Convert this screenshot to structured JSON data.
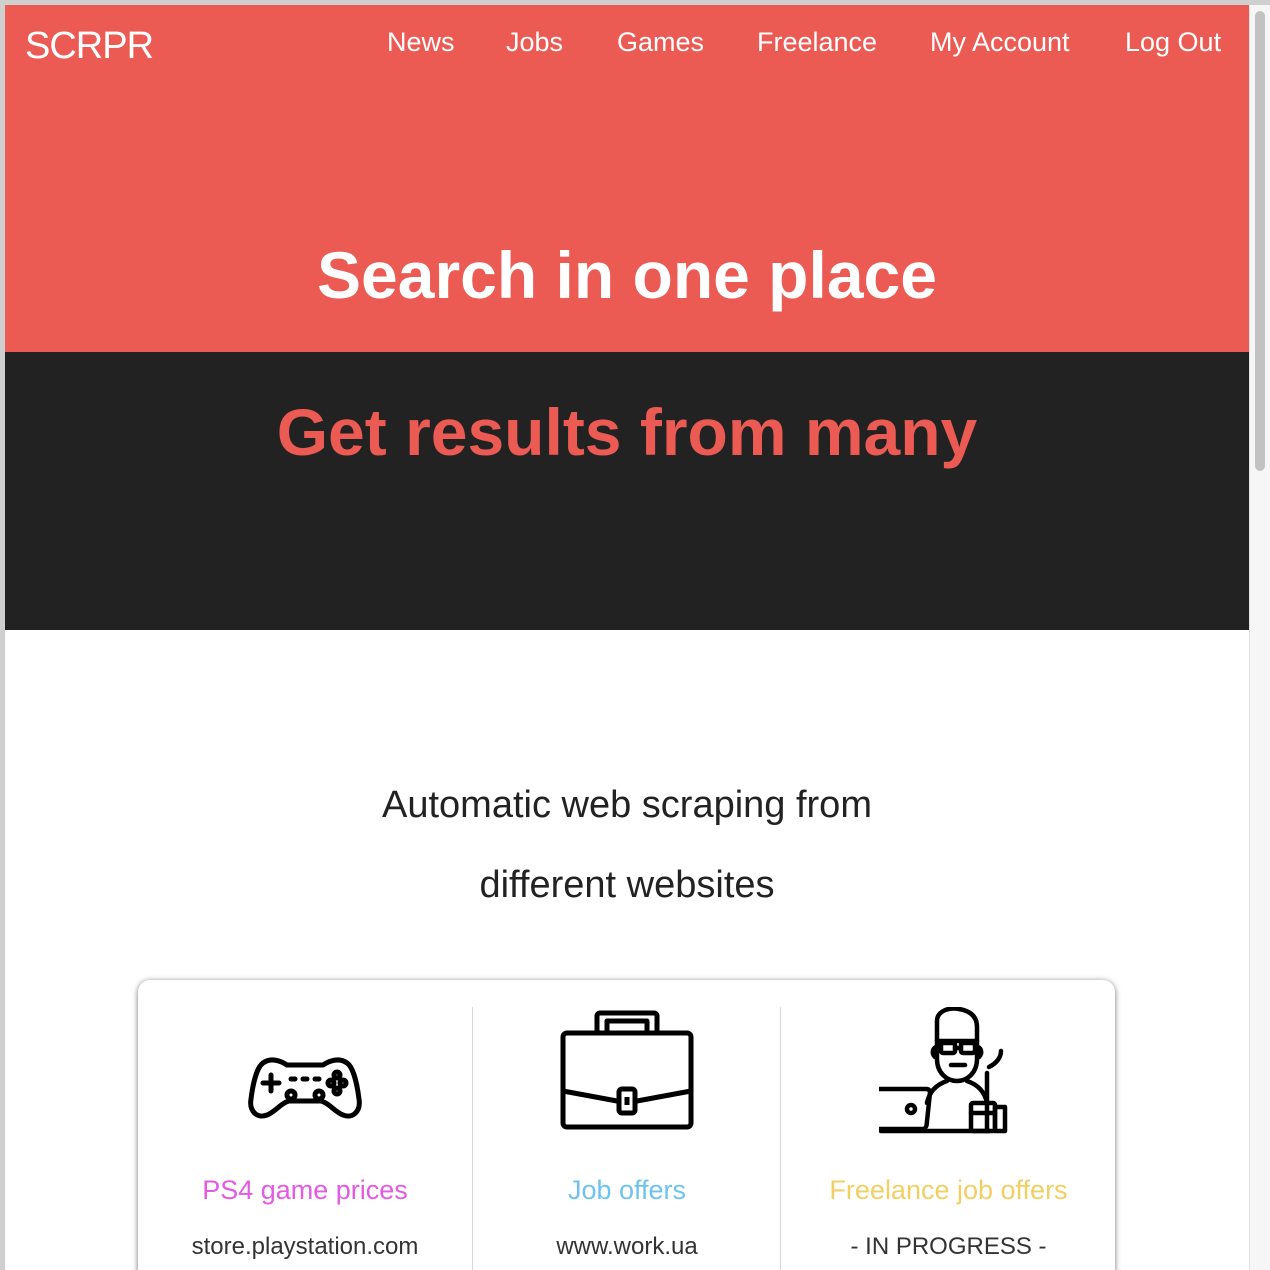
{
  "brand": "SCRPR",
  "nav": [
    "News",
    "Jobs",
    "Games",
    "Freelance",
    "My Account",
    "Log Out"
  ],
  "hero": {
    "title": "Search in one place",
    "subtitle": "Get results from many"
  },
  "intro": {
    "line1": "Automatic web scraping from",
    "line2": "different websites"
  },
  "colors": {
    "accent": "#ec5b53",
    "dark": "#222222",
    "games": "#e35ae3",
    "jobs": "#6ec3ee",
    "freelance": "#f2cf63"
  },
  "cards": [
    {
      "icon": "gamepad-icon",
      "title": "PS4 game prices",
      "site": "store.playstation.com"
    },
    {
      "icon": "briefcase-icon",
      "title": "Job offers",
      "site": "www.work.ua"
    },
    {
      "icon": "freelancer-icon",
      "title": "Freelance job offers",
      "site": "- IN PROGRESS -"
    }
  ]
}
